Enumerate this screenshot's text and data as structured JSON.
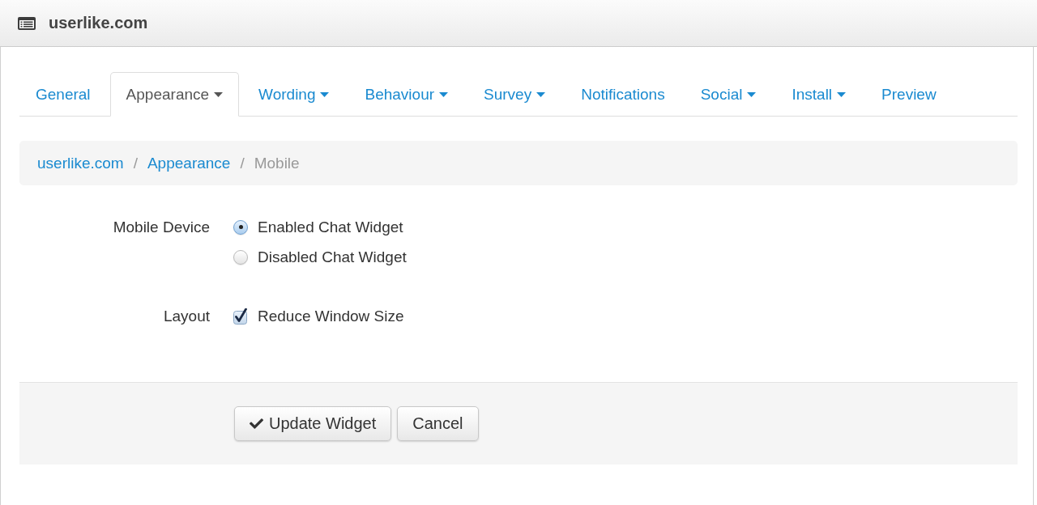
{
  "window": {
    "title": "userlike.com"
  },
  "tabs": [
    {
      "label": "General",
      "selected": false,
      "dropdown": false
    },
    {
      "label": "Appearance",
      "selected": true,
      "dropdown": true
    },
    {
      "label": "Wording",
      "selected": false,
      "dropdown": true
    },
    {
      "label": "Behaviour",
      "selected": false,
      "dropdown": true
    },
    {
      "label": "Survey",
      "selected": false,
      "dropdown": true
    },
    {
      "label": "Notifications",
      "selected": false,
      "dropdown": false
    },
    {
      "label": "Social",
      "selected": false,
      "dropdown": true
    },
    {
      "label": "Install",
      "selected": false,
      "dropdown": true
    },
    {
      "label": "Preview",
      "selected": false,
      "dropdown": false
    }
  ],
  "breadcrumb": {
    "separator": "/",
    "items": [
      {
        "label": "userlike.com",
        "kind": "link"
      },
      {
        "label": "Appearance",
        "kind": "link"
      },
      {
        "label": "Mobile",
        "kind": "current"
      }
    ]
  },
  "form": {
    "fields": [
      {
        "label": "Mobile Device",
        "kind": "radio",
        "options": [
          {
            "label": "Enabled Chat Widget",
            "selected": true
          },
          {
            "label": "Disabled Chat Widget",
            "selected": false
          }
        ]
      },
      {
        "label": "Layout",
        "kind": "checkbox",
        "options": [
          {
            "label": "Reduce Window Size",
            "checked": true
          }
        ]
      }
    ]
  },
  "buttons": [
    {
      "label": "Update Widget",
      "kind": "submit"
    },
    {
      "label": "Cancel",
      "kind": "cancel"
    }
  ]
}
